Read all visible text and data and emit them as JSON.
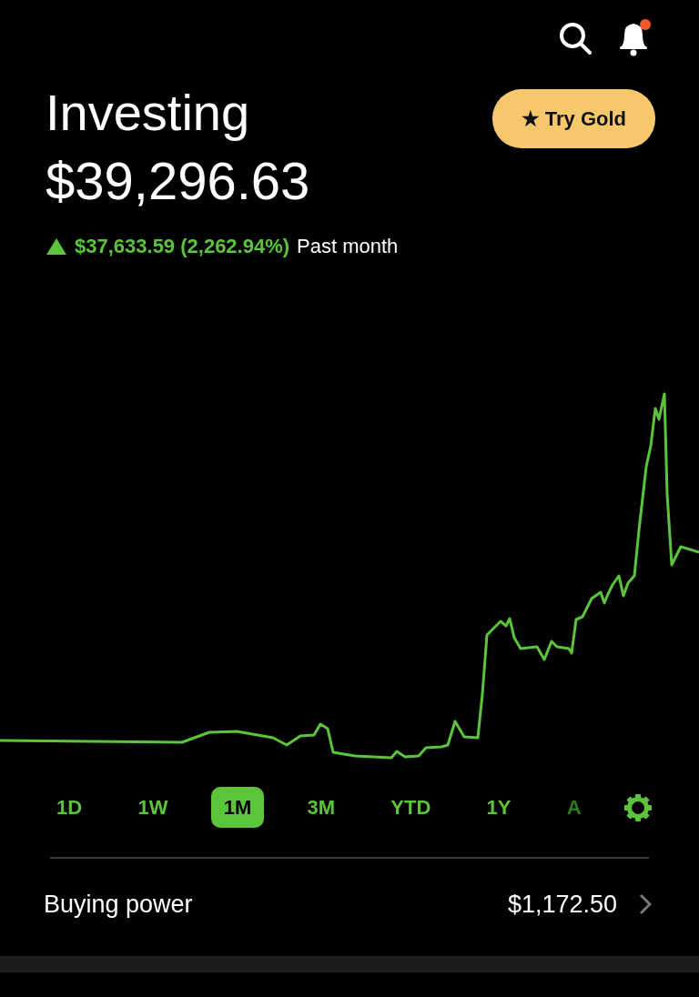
{
  "header": {
    "title": "Investing",
    "value": "$39,296.63",
    "change": "$37,633.59 (2,262.94%)",
    "period": "Past month",
    "gain": true,
    "notification": true
  },
  "gold_button": {
    "label": "★ Try Gold"
  },
  "ranges": [
    {
      "label": "1D",
      "selected": false,
      "faded": false
    },
    {
      "label": "1W",
      "selected": false,
      "faded": false
    },
    {
      "label": "1M",
      "selected": true,
      "faded": false
    },
    {
      "label": "3M",
      "selected": false,
      "faded": false
    },
    {
      "label": "YTD",
      "selected": false,
      "faded": false
    },
    {
      "label": "1Y",
      "selected": false,
      "faded": false
    },
    {
      "label": "A",
      "selected": false,
      "faded": true
    }
  ],
  "buying_power": {
    "label": "Buying power",
    "value": "$1,172.50"
  }
}
